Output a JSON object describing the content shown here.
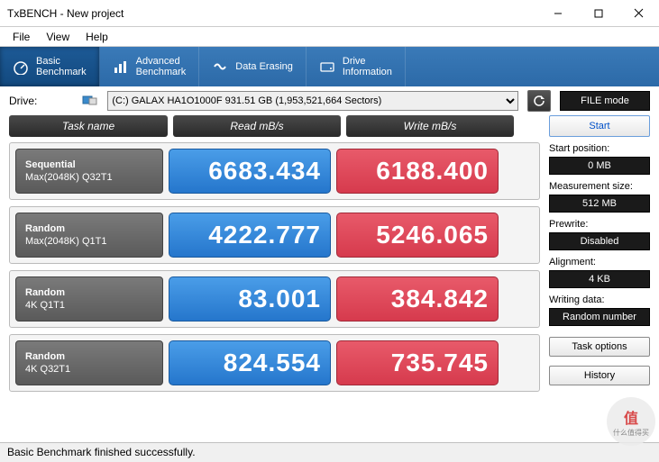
{
  "window": {
    "title": "TxBENCH - New project"
  },
  "menu": {
    "file": "File",
    "view": "View",
    "help": "Help"
  },
  "tabs": {
    "basic": {
      "l1": "Basic",
      "l2": "Benchmark"
    },
    "advanced": {
      "l1": "Advanced",
      "l2": "Benchmark"
    },
    "erasing": {
      "l1": "Data Erasing"
    },
    "drive": {
      "l1": "Drive",
      "l2": "Information"
    }
  },
  "drivebar": {
    "label": "Drive:",
    "selected": "(C:) GALAX HA1O1000F   931.51 GB (1,953,521,664 Sectors)",
    "filemode": "FILE mode"
  },
  "headers": {
    "task": "Task name",
    "read": "Read mB/s",
    "write": "Write mB/s"
  },
  "rows": [
    {
      "name1": "Sequential",
      "name2": "Max(2048K) Q32T1",
      "read": "6683.434",
      "write": "6188.400"
    },
    {
      "name1": "Random",
      "name2": "Max(2048K) Q1T1",
      "read": "4222.777",
      "write": "5246.065"
    },
    {
      "name1": "Random",
      "name2": "4K Q1T1",
      "read": "83.001",
      "write": "384.842"
    },
    {
      "name1": "Random",
      "name2": "4K Q32T1",
      "read": "824.554",
      "write": "735.745"
    }
  ],
  "side": {
    "start": "Start",
    "startpos_l": "Start position:",
    "startpos_v": "0 MB",
    "meassize_l": "Measurement size:",
    "meassize_v": "512 MB",
    "prewrite_l": "Prewrite:",
    "prewrite_v": "Disabled",
    "align_l": "Alignment:",
    "align_v": "4 KB",
    "wdata_l": "Writing data:",
    "wdata_v": "Random number",
    "taskopt": "Task options",
    "history": "History"
  },
  "status": "Basic Benchmark finished successfully.",
  "watermark": {
    "big": "值",
    "small": "什么值得买"
  }
}
